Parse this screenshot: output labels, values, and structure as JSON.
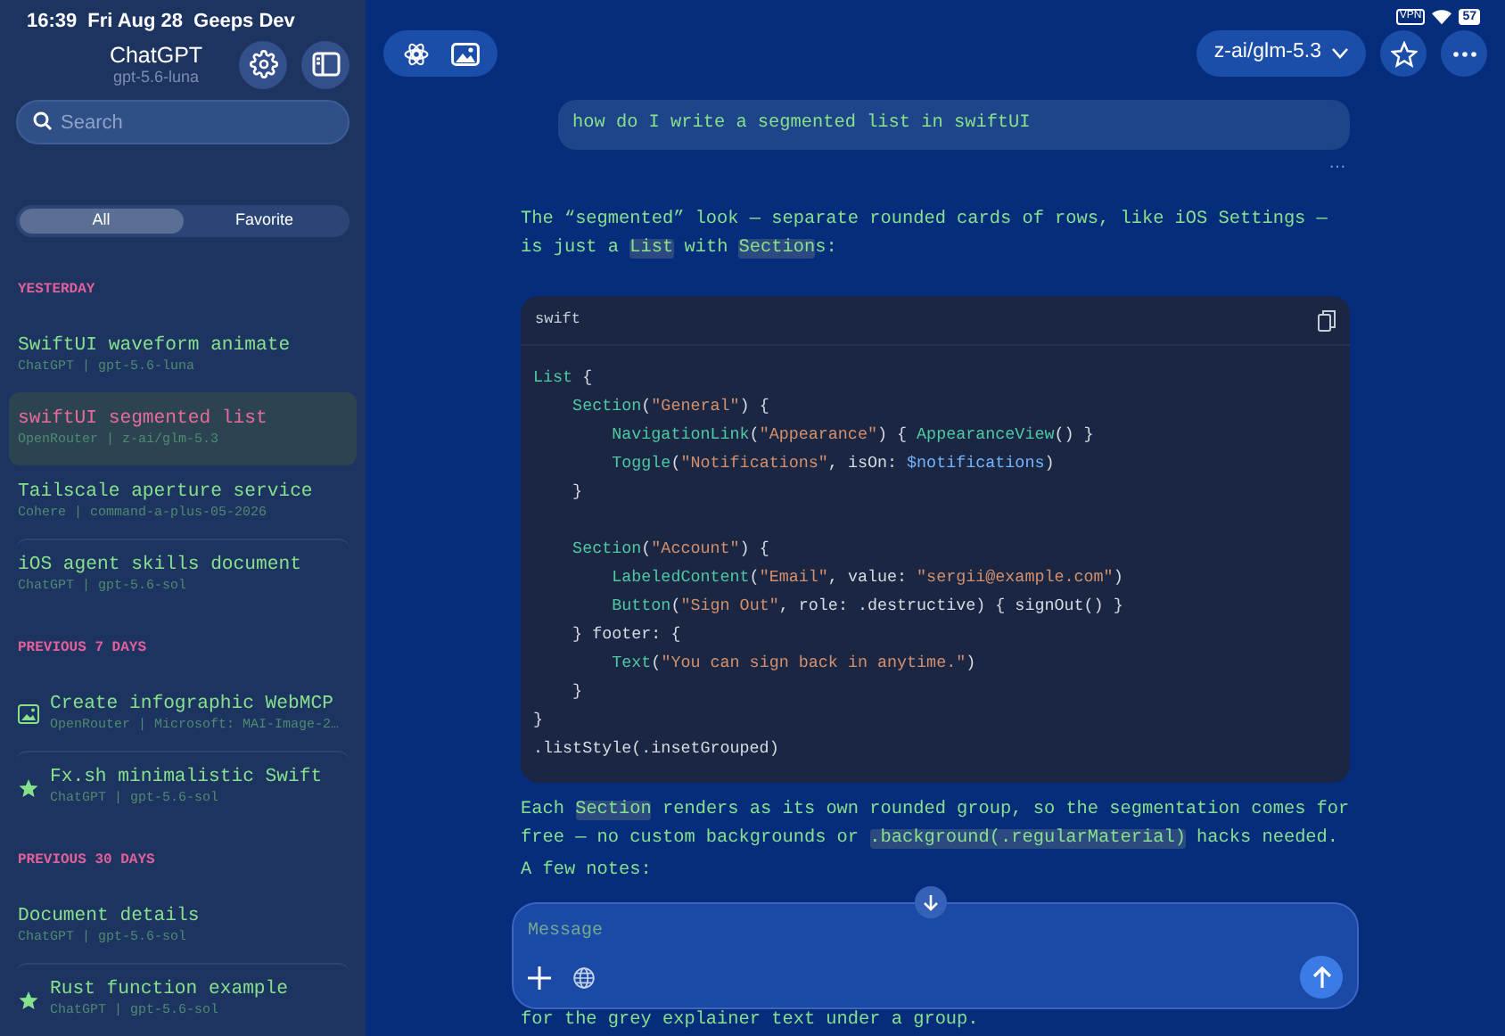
{
  "status_bar": {
    "time": "16:39",
    "date": "Fri Aug 28",
    "device": "Geeps Dev",
    "vpn": "VPN",
    "battery": "57"
  },
  "sidebar": {
    "title": "ChatGPT",
    "subtitle": "gpt-5.6-luna",
    "search": {
      "placeholder": "Search"
    },
    "filters": [
      {
        "label": "All",
        "selected": true
      },
      {
        "label": "Favorite",
        "selected": false
      }
    ],
    "groups": [
      {
        "header": "YESTERDAY",
        "items": [
          {
            "title": "SwiftUI waveform animate",
            "subtitle": "ChatGPT | gpt-5.6-luna",
            "selected": false,
            "kind": "plain"
          },
          {
            "title": "swiftUI segmented list",
            "subtitle": "OpenRouter | z-ai/glm-5.3",
            "selected": true,
            "kind": "plain"
          },
          {
            "title": "Tailscale aperture service",
            "subtitle": "Cohere | command-a-plus-05-2026",
            "selected": false,
            "kind": "plain"
          },
          {
            "title": "iOS agent skills document",
            "subtitle": "ChatGPT | gpt-5.6-sol",
            "selected": false,
            "kind": "plain"
          }
        ]
      },
      {
        "header": "PREVIOUS 7 DAYS",
        "items": [
          {
            "title": "Create infographic WebMCP",
            "subtitle": "OpenRouter | Microsoft: MAI-Image-2…",
            "selected": false,
            "kind": "image"
          },
          {
            "title": "Fx.sh minimalistic Swift",
            "subtitle": "ChatGPT | gpt-5.6-sol",
            "selected": false,
            "kind": "favorite"
          }
        ]
      },
      {
        "header": "PREVIOUS 30 DAYS",
        "items": [
          {
            "title": "Document details",
            "subtitle": "ChatGPT | gpt-5.6-sol",
            "selected": false,
            "kind": "plain"
          },
          {
            "title": "Rust function example",
            "subtitle": "ChatGPT | gpt-5.6-sol",
            "selected": false,
            "kind": "favorite"
          }
        ]
      }
    ]
  },
  "toolbar": {
    "model": "z-ai/glm-5.3"
  },
  "chat": {
    "user_message": "how do I write a segmented list in swiftUI",
    "more": "…",
    "intro": [
      {
        "t": "The “segmented” look — separate rounded cards of rows, like iOS Settings — is just a ",
        "code": false
      },
      {
        "t": "List",
        "code": true
      },
      {
        "t": " with ",
        "code": false
      },
      {
        "t": "Section",
        "code": true
      },
      {
        "t": "s:",
        "code": false
      }
    ],
    "code_block": {
      "language": "swift",
      "lines": [
        {
          "gap_before": false,
          "tokens": [
            {
              "t": "List",
              "kind": "type"
            },
            {
              "t": " {",
              "kind": "plain"
            }
          ]
        },
        {
          "gap_before": false,
          "tokens": [
            {
              "t": "    Section",
              "kind": "type"
            },
            {
              "t": "(",
              "kind": "plain"
            },
            {
              "t": "\"General\"",
              "kind": "string"
            },
            {
              "t": ") {",
              "kind": "plain"
            }
          ]
        },
        {
          "gap_before": false,
          "tokens": [
            {
              "t": "        NavigationLink",
              "kind": "type"
            },
            {
              "t": "(",
              "kind": "plain"
            },
            {
              "t": "\"Appearance\"",
              "kind": "string"
            },
            {
              "t": ") { ",
              "kind": "plain"
            },
            {
              "t": "AppearanceView",
              "kind": "type"
            },
            {
              "t": "() }",
              "kind": "plain"
            }
          ]
        },
        {
          "gap_before": false,
          "tokens": [
            {
              "t": "        Toggle",
              "kind": "type"
            },
            {
              "t": "(",
              "kind": "plain"
            },
            {
              "t": "\"Notifications\"",
              "kind": "string"
            },
            {
              "t": ", isOn: ",
              "kind": "plain"
            },
            {
              "t": "$notifications",
              "kind": "var"
            },
            {
              "t": ")",
              "kind": "plain"
            }
          ]
        },
        {
          "gap_before": false,
          "tokens": [
            {
              "t": "    }",
              "kind": "plain"
            }
          ]
        },
        {
          "gap_before": true,
          "tokens": [
            {
              "t": "    Section",
              "kind": "type"
            },
            {
              "t": "(",
              "kind": "plain"
            },
            {
              "t": "\"Account\"",
              "kind": "string"
            },
            {
              "t": ") {",
              "kind": "plain"
            }
          ]
        },
        {
          "gap_before": false,
          "tokens": [
            {
              "t": "        LabeledContent",
              "kind": "type"
            },
            {
              "t": "(",
              "kind": "plain"
            },
            {
              "t": "\"Email\"",
              "kind": "string"
            },
            {
              "t": ", value: ",
              "kind": "plain"
            },
            {
              "t": "\"sergii@example.com\"",
              "kind": "string"
            },
            {
              "t": ")",
              "kind": "plain"
            }
          ]
        },
        {
          "gap_before": false,
          "tokens": [
            {
              "t": "        Button",
              "kind": "type"
            },
            {
              "t": "(",
              "kind": "plain"
            },
            {
              "t": "\"Sign Out\"",
              "kind": "string"
            },
            {
              "t": ", role: .destructive) { signOut() }",
              "kind": "plain"
            }
          ]
        },
        {
          "gap_before": false,
          "tokens": [
            {
              "t": "    } footer: {",
              "kind": "plain"
            }
          ]
        },
        {
          "gap_before": false,
          "tokens": [
            {
              "t": "        Text",
              "kind": "type"
            },
            {
              "t": "(",
              "kind": "plain"
            },
            {
              "t": "\"You can sign back in anytime.\"",
              "kind": "string"
            },
            {
              "t": ")",
              "kind": "plain"
            }
          ]
        },
        {
          "gap_before": false,
          "tokens": [
            {
              "t": "    }",
              "kind": "plain"
            }
          ]
        },
        {
          "gap_before": false,
          "tokens": [
            {
              "t": "}",
              "kind": "plain"
            }
          ]
        },
        {
          "gap_before": false,
          "tokens": [
            {
              "t": ".listStyle(.insetGrouped)",
              "kind": "plain"
            }
          ]
        }
      ]
    },
    "after": [
      {
        "t": "Each ",
        "code": false
      },
      {
        "t": "Section",
        "code": true
      },
      {
        "t": " renders as its own rounded group, so the segmentation comes for free — no custom backgrounds or ",
        "code": false
      },
      {
        "t": ".background(.regularMaterial)",
        "code": true
      },
      {
        "t": " hacks needed.",
        "code": false
      }
    ],
    "notes_heading": "A few notes:",
    "trailing_line": "for the grey explainer text under a group."
  },
  "composer": {
    "placeholder": "Message"
  }
}
